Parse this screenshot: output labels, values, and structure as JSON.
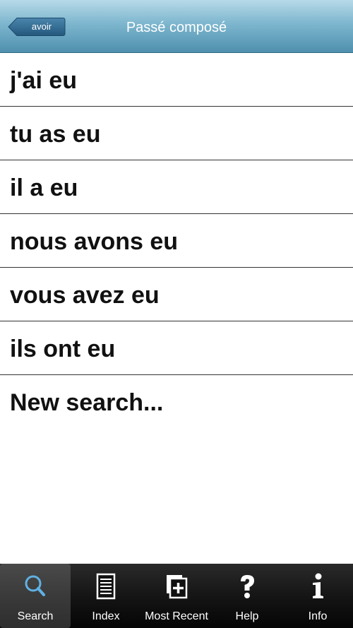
{
  "header": {
    "back_label": "avoir",
    "title": "Passé composé"
  },
  "conjugations": [
    "j'ai eu",
    "tu as eu",
    "il a eu",
    "nous avons eu",
    "vous avez eu",
    "ils ont eu"
  ],
  "new_search_label": "New search...",
  "tabbar": {
    "active": "Search",
    "tabs": [
      {
        "label": "Search",
        "icon": "search-icon"
      },
      {
        "label": "Index",
        "icon": "index-icon"
      },
      {
        "label": "Most Recent",
        "icon": "most-recent-icon"
      },
      {
        "label": "Help",
        "icon": "help-icon"
      },
      {
        "label": "Info",
        "icon": "info-icon"
      }
    ]
  },
  "colors": {
    "header_top": "#b7dae8",
    "header_bottom": "#4f90ae",
    "back_button": "#2f6c93",
    "tabbar": "#151515",
    "active_icon": "#5fb1e4"
  }
}
